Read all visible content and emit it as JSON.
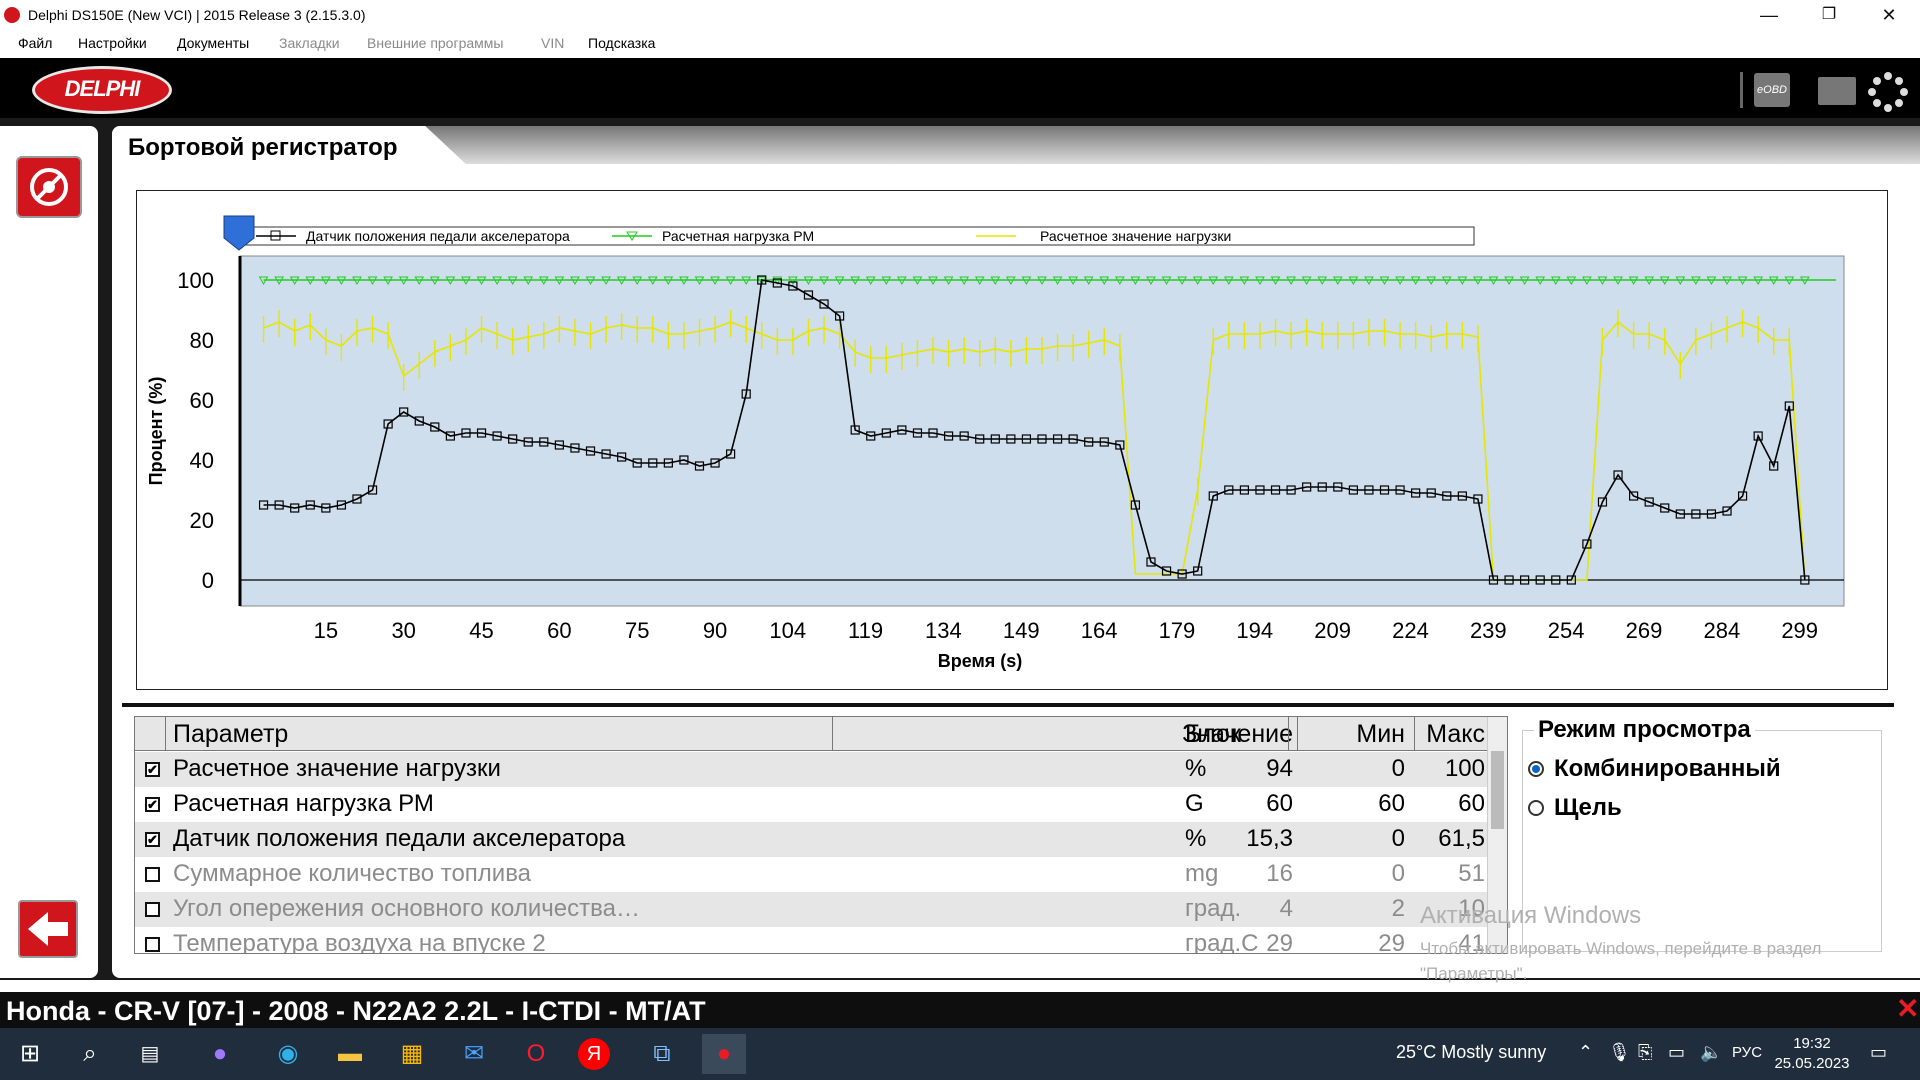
{
  "window": {
    "title": "Delphi DS150E (New VCI) | 2015 Release 3 (2.15.3.0)",
    "min": "—",
    "max": "❐",
    "close": "✕"
  },
  "menu": [
    "Файл",
    "Настройки",
    "Документы",
    "Закладки",
    "Внешние программы",
    "VIN",
    "Подсказка"
  ],
  "header": {
    "logo": "DELPHI",
    "eobd": "eOBD"
  },
  "page": {
    "title": "Бортовой регистратор"
  },
  "chart_data": {
    "type": "line",
    "xlabel": "Время (s)",
    "ylabel": "Процент (%)",
    "ylim": [
      0,
      100
    ],
    "xlim": [
      0,
      306
    ],
    "x_ticks": [
      15,
      30,
      45,
      60,
      75,
      90,
      104,
      119,
      134,
      149,
      164,
      179,
      194,
      209,
      224,
      239,
      254,
      269,
      284,
      299
    ],
    "y_ticks": [
      0,
      20,
      40,
      60,
      80,
      100
    ],
    "legend": [
      "Датчик положения педали акселератора",
      "Расчетная нагрузка РМ",
      "Расчетное значение нагрузки"
    ],
    "colors": {
      "pedal": "#000000",
      "engine_load": "#22cc22",
      "calc_load": "#e6e600",
      "plot_bg": "#cfdeec"
    },
    "series": [
      {
        "name": "Датчик положения педали акселератора",
        "x": [
          3,
          6,
          9,
          12,
          15,
          18,
          21,
          24,
          27,
          30,
          33,
          36,
          39,
          42,
          45,
          48,
          51,
          54,
          57,
          60,
          63,
          66,
          69,
          72,
          75,
          78,
          81,
          84,
          87,
          90,
          93,
          96,
          99,
          102,
          105,
          108,
          111,
          114,
          117,
          120,
          123,
          126,
          129,
          132,
          135,
          138,
          141,
          144,
          147,
          150,
          153,
          156,
          159,
          162,
          165,
          168,
          171,
          174,
          177,
          180,
          183,
          186,
          189,
          192,
          195,
          198,
          201,
          204,
          207,
          210,
          213,
          216,
          219,
          222,
          225,
          228,
          231,
          234,
          237,
          240,
          243,
          246,
          249,
          252,
          255,
          258,
          261,
          264,
          267,
          270,
          273,
          276,
          279,
          282,
          285,
          288,
          291,
          294,
          297,
          300
        ],
        "values": [
          25,
          25,
          24,
          25,
          24,
          25,
          27,
          30,
          52,
          56,
          53,
          51,
          48,
          49,
          49,
          48,
          47,
          46,
          46,
          45,
          44,
          43,
          42,
          41,
          39,
          39,
          39,
          40,
          38,
          39,
          42,
          62,
          100,
          99,
          98,
          95,
          92,
          88,
          50,
          48,
          49,
          50,
          49,
          49,
          48,
          48,
          47,
          47,
          47,
          47,
          47,
          47,
          47,
          46,
          46,
          45,
          25,
          6,
          3,
          2,
          3,
          28,
          30,
          30,
          30,
          30,
          30,
          31,
          31,
          31,
          30,
          30,
          30,
          30,
          29,
          29,
          28,
          28,
          27,
          0,
          0,
          0,
          0,
          0,
          0,
          12,
          26,
          35,
          28,
          26,
          24,
          22,
          22,
          22,
          23,
          28,
          48,
          38,
          58,
          0
        ]
      },
      {
        "name": "Расчетная нагрузка РМ",
        "x": [
          3,
          306
        ],
        "values": [
          100,
          100
        ]
      },
      {
        "name": "Расчетное значение нагрузки",
        "x": [
          3,
          6,
          9,
          12,
          15,
          18,
          21,
          24,
          27,
          30,
          33,
          36,
          39,
          42,
          45,
          48,
          51,
          54,
          57,
          60,
          63,
          66,
          69,
          72,
          75,
          78,
          81,
          84,
          87,
          90,
          93,
          96,
          99,
          102,
          105,
          108,
          111,
          114,
          117,
          120,
          123,
          126,
          129,
          132,
          135,
          138,
          141,
          144,
          147,
          150,
          153,
          156,
          159,
          162,
          165,
          168,
          171,
          174,
          177,
          180,
          183,
          186,
          189,
          192,
          195,
          198,
          201,
          204,
          207,
          210,
          213,
          216,
          219,
          222,
          225,
          228,
          231,
          234,
          237,
          240,
          243,
          246,
          249,
          252,
          255,
          258,
          261,
          264,
          267,
          270,
          273,
          276,
          279,
          282,
          285,
          288,
          291,
          294,
          297,
          300
        ],
        "values": [
          84,
          86,
          83,
          85,
          80,
          78,
          83,
          84,
          82,
          68,
          72,
          76,
          78,
          80,
          84,
          82,
          80,
          81,
          82,
          84,
          83,
          82,
          84,
          85,
          84,
          84,
          82,
          82,
          83,
          84,
          86,
          84,
          82,
          80,
          80,
          83,
          84,
          82,
          76,
          74,
          74,
          75,
          76,
          77,
          76,
          77,
          76,
          77,
          76,
          77,
          77,
          78,
          78,
          79,
          80,
          78,
          2,
          2,
          2,
          2,
          30,
          80,
          82,
          82,
          82,
          83,
          82,
          83,
          82,
          82,
          82,
          83,
          83,
          82,
          82,
          81,
          82,
          82,
          81,
          0,
          0,
          0,
          0,
          0,
          0,
          0,
          80,
          86,
          82,
          82,
          80,
          72,
          80,
          82,
          84,
          86,
          84,
          80,
          80,
          0
        ]
      }
    ]
  },
  "table": {
    "headers": {
      "param": "Параметр",
      "value": "Значение",
      "unit": "Блок",
      "min": "Мин",
      "max": "Макс"
    },
    "rows": [
      {
        "checked": true,
        "param": "Расчетное значение нагрузки",
        "value": "94",
        "unit": "%",
        "min": "0",
        "max": "100"
      },
      {
        "checked": true,
        "param": "Расчетная нагрузка РМ",
        "value": "60",
        "unit": "G",
        "min": "60",
        "max": "60"
      },
      {
        "checked": true,
        "param": "Датчик положения педали акселератора",
        "value": "15,3",
        "unit": "%",
        "min": "0",
        "max": "61,5"
      },
      {
        "checked": false,
        "param": "Суммарное количество топлива",
        "value": "16",
        "unit": "mg",
        "min": "0",
        "max": "51"
      },
      {
        "checked": false,
        "param": "Угол опережения основного количества…",
        "value": "4",
        "unit": "град.",
        "min": "2",
        "max": "10"
      },
      {
        "checked": false,
        "param": "Температура воздуха на впуске 2",
        "value": "29",
        "unit": "град.С",
        "min": "29",
        "max": "41"
      }
    ]
  },
  "view_mode": {
    "title": "Режим просмотра",
    "options": [
      "Комбинированный",
      "Щель"
    ],
    "selected": 0
  },
  "activation": {
    "line1": "Активация Windows",
    "line2": "Чтобы активировать Windows, перейдите в раздел \"Параметры\"."
  },
  "vehicle": "Honda - CR-V [07-] - 2008 - N22A2 2.2L - I-CTDI - MT/AT",
  "taskbar": {
    "weather": "25°C  Mostly sunny",
    "lang": "РУС",
    "time": "19:32",
    "date": "25.05.2023"
  }
}
